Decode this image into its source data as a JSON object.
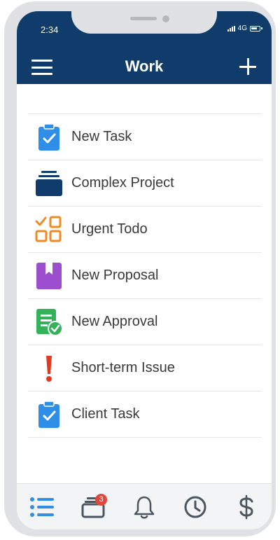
{
  "status_bar": {
    "time": "2:34",
    "network": "4G"
  },
  "header": {
    "title": "Work"
  },
  "tasks": [
    {
      "label": "New Task",
      "icon": "clipboard-check-icon",
      "color": "#2f8fe8"
    },
    {
      "label": "Complex Project",
      "icon": "stacked-folders-icon",
      "color": "#0f3c6b"
    },
    {
      "label": "Urgent Todo",
      "icon": "checklist-grid-icon",
      "color": "#f08a24"
    },
    {
      "label": "New Proposal",
      "icon": "bookmark-icon",
      "color": "#9b4fcf"
    },
    {
      "label": "New Approval",
      "icon": "document-approved-icon",
      "color": "#34b25a"
    },
    {
      "label": "Short-term Issue",
      "icon": "exclamation-icon",
      "color": "#e03a24"
    },
    {
      "label": "Client Task",
      "icon": "clipboard-check-icon",
      "color": "#2f8fe8"
    }
  ],
  "bottom_nav": {
    "items": [
      {
        "name": "list",
        "icon": "list-icon",
        "active": true
      },
      {
        "name": "cards",
        "icon": "cards-icon",
        "badge": "3"
      },
      {
        "name": "notifications",
        "icon": "bell-icon"
      },
      {
        "name": "history",
        "icon": "clock-icon"
      },
      {
        "name": "billing",
        "icon": "dollar-icon"
      }
    ]
  },
  "colors": {
    "header_bg": "#0f3c6b",
    "accent_blue": "#2f8fe8",
    "badge": "#e0463a"
  }
}
